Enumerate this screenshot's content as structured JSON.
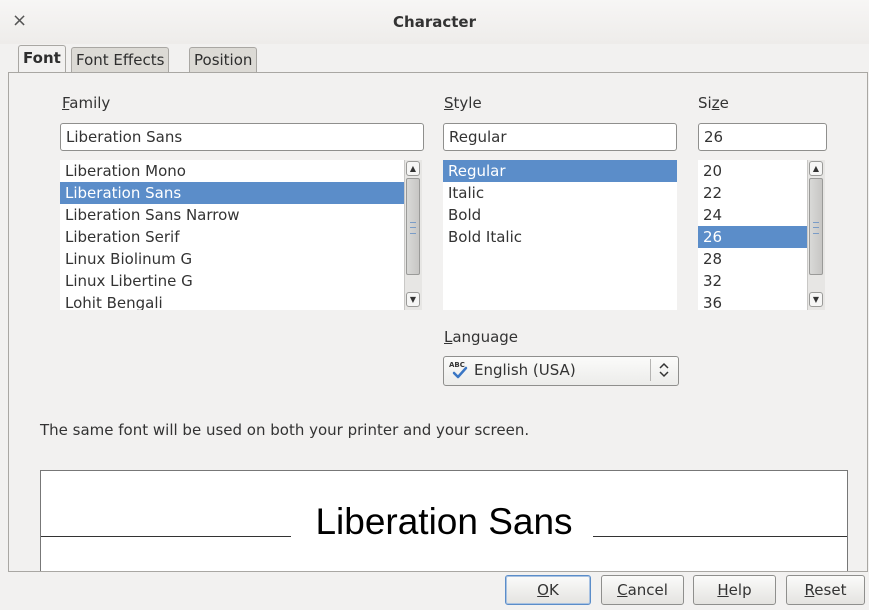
{
  "window": {
    "title": "Character",
    "close_glyph": "×"
  },
  "tabs": [
    {
      "label": "Font",
      "active": true
    },
    {
      "label": "Font Effects",
      "active": false
    },
    {
      "label": "Position",
      "active": false
    }
  ],
  "family": {
    "label_mnemonic": "F",
    "label_rest": "amily",
    "value": "Liberation Sans",
    "options": [
      "Liberation Mono",
      "Liberation Sans",
      "Liberation Sans Narrow",
      "Liberation Serif",
      "Linux Biolinum G",
      "Linux Libertine G",
      "Lohit Bengali"
    ],
    "selected_index": 1
  },
  "style": {
    "label_mnemonic": "S",
    "label_rest": "tyle",
    "value": "Regular",
    "options": [
      "Regular",
      "Italic",
      "Bold",
      "Bold Italic"
    ],
    "selected_index": 0
  },
  "size": {
    "label_pre": "Si",
    "label_mnemonic": "z",
    "label_rest": "e",
    "value": "26",
    "options": [
      "20",
      "22",
      "24",
      "26",
      "28",
      "32",
      "36"
    ],
    "selected_index": 3
  },
  "language": {
    "label_mnemonic": "L",
    "label_rest": "anguage",
    "value": "English (USA)",
    "icon": "spellcheck-icon",
    "icon_text": "ABC"
  },
  "info_text": "The same font will be used on both your printer and your screen.",
  "preview": {
    "text": "Liberation Sans"
  },
  "buttons": {
    "ok": {
      "mnemonic": "O",
      "rest": "K"
    },
    "cancel": {
      "mnemonic": "C",
      "rest": "ancel"
    },
    "help": {
      "mnemonic": "H",
      "rest": "elp"
    },
    "reset": {
      "mnemonic": "R",
      "rest": "eset"
    }
  },
  "colors": {
    "selection": "#5b8dc9",
    "background": "#f2f1f0"
  }
}
